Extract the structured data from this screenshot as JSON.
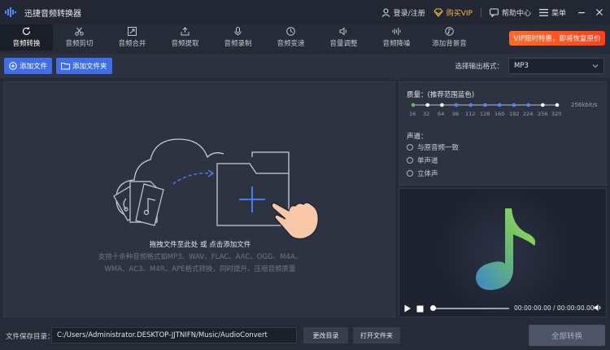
{
  "app": {
    "title": "迅捷音频转换器"
  },
  "titlebar": {
    "login": "登录/注册",
    "vip": "购买VIP",
    "help": "帮助中心",
    "menu": "菜单"
  },
  "tabs": [
    {
      "label": "音频转换",
      "icon": "refresh-icon"
    },
    {
      "label": "音频剪切",
      "icon": "scissors-icon"
    },
    {
      "label": "音频合并",
      "icon": "merge-icon"
    },
    {
      "label": "音频提取",
      "icon": "extract-icon"
    },
    {
      "label": "音频录制",
      "icon": "microphone-icon"
    },
    {
      "label": "音频变速",
      "icon": "speed-icon"
    },
    {
      "label": "音量调整",
      "icon": "volume-icon"
    },
    {
      "label": "音频降噪",
      "icon": "noise-icon"
    },
    {
      "label": "添加背景音",
      "icon": "music-note-icon"
    }
  ],
  "promo": {
    "text": "VIP限时特惠，即将恢复原价"
  },
  "toolbar": {
    "add_file": "添加文件",
    "add_folder": "添加文件夹",
    "format_label": "选择输出格式：",
    "format_value": "MP3"
  },
  "dropzone": {
    "title": "拖拽文件至此处 或 点击添加文件",
    "line1": "支持十余种音频格式如MP3、WAV、FLAC、AAC、OGG、M4A、",
    "line2": "WMA、AC3、M4R、APE格式转换，同时提升、压缩音频质量"
  },
  "settings": {
    "quality_label": "质量：(推荐范围蓝色)",
    "quality_ticks": [
      "16",
      "32",
      "64",
      "96",
      "112",
      "128",
      "160",
      "192",
      "224",
      "256",
      "320"
    ],
    "quality_value": "256kbit/s",
    "channel_label": "声道：",
    "channel_options": [
      "与原音频一致",
      "单声道",
      "立体声"
    ]
  },
  "player": {
    "time": "00:00:00.00 / 00:00:00.00"
  },
  "bottom": {
    "path_label": "文件保存目录：",
    "path": "C:/Users/Administrator.DESKTOP-JJTNIFN/Music/AudioConvert",
    "change_dir": "更改目录",
    "open_folder": "打开文件夹",
    "convert_all": "全部转换"
  },
  "colors": {
    "accent": "#3f6ee8",
    "promo": "#ff4b1f",
    "vip": "#f5b84a",
    "bg": "#262b37"
  }
}
